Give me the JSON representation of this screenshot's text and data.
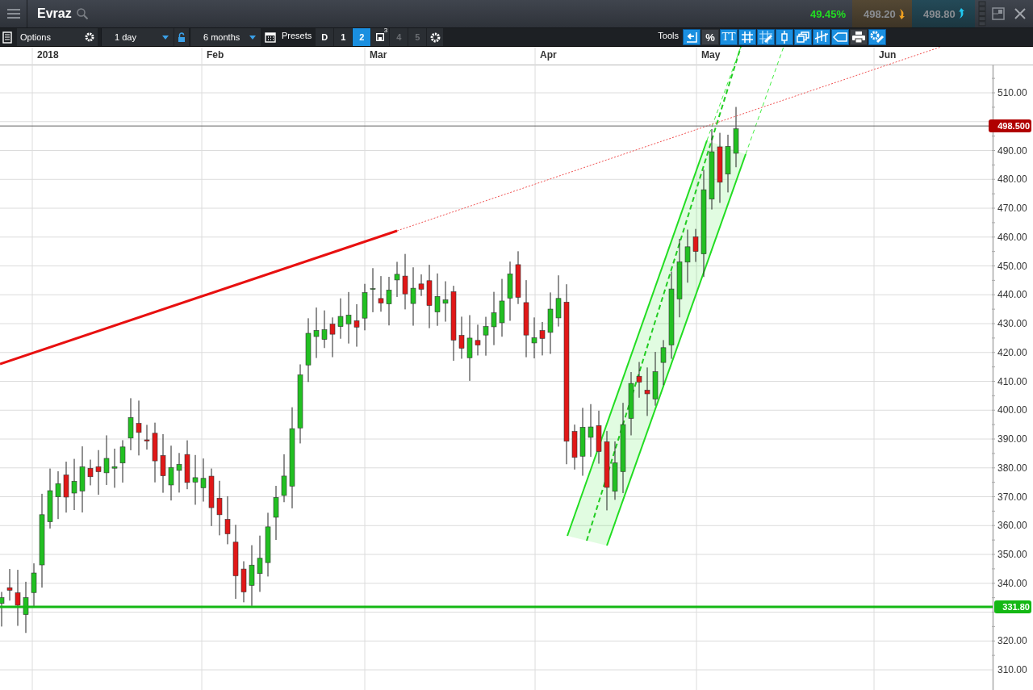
{
  "header": {
    "instrument": "Evraz",
    "change": "49.45%",
    "sell_price": "498.20",
    "buy_price": "498.80"
  },
  "toolbar": {
    "options_label": "Options",
    "interval": "1 day",
    "range": "6 months",
    "presets_label": "Presets",
    "presets": [
      {
        "label": "D",
        "kind": "plain",
        "selected": false,
        "disabled": false
      },
      {
        "label": "1",
        "kind": "plain",
        "selected": false,
        "disabled": false
      },
      {
        "label": "2",
        "kind": "plain",
        "selected": true,
        "disabled": false
      },
      {
        "label": "3",
        "kind": "saved",
        "selected": false,
        "disabled": false
      },
      {
        "label": "4",
        "kind": "plain",
        "selected": false,
        "disabled": true
      },
      {
        "label": "5",
        "kind": "plain",
        "selected": false,
        "disabled": true
      }
    ],
    "tools_label": "Tools",
    "tools": [
      {
        "kind": "exit",
        "active": true
      },
      {
        "kind": "percent",
        "label": "%",
        "active": false
      },
      {
        "kind": "text",
        "label": "TT",
        "active": true
      },
      {
        "kind": "grid",
        "active": true
      },
      {
        "kind": "draw",
        "active": true
      },
      {
        "kind": "candle",
        "active": true
      },
      {
        "kind": "layers",
        "active": true
      },
      {
        "kind": "bars",
        "active": true
      },
      {
        "kind": "tag",
        "active": true
      },
      {
        "kind": "print",
        "active": false
      },
      {
        "kind": "settings",
        "active": true
      }
    ]
  },
  "chart": {
    "months": [
      "2018",
      "Feb",
      "Mar",
      "Apr",
      "May",
      "Jun"
    ],
    "y_labels": [
      "510.00",
      "490.00",
      "480.00",
      "470.00",
      "460.00",
      "450.00",
      "440.00",
      "430.00",
      "420.00",
      "410.00",
      "400.00",
      "390.00",
      "380.00",
      "370.00",
      "360.00",
      "350.00",
      "340.00",
      "320.00",
      "310.00"
    ],
    "price_tags": [
      {
        "text": "498.500",
        "color": "#b00000"
      },
      {
        "text": "331.80",
        "color": "#14b814"
      }
    ]
  }
}
